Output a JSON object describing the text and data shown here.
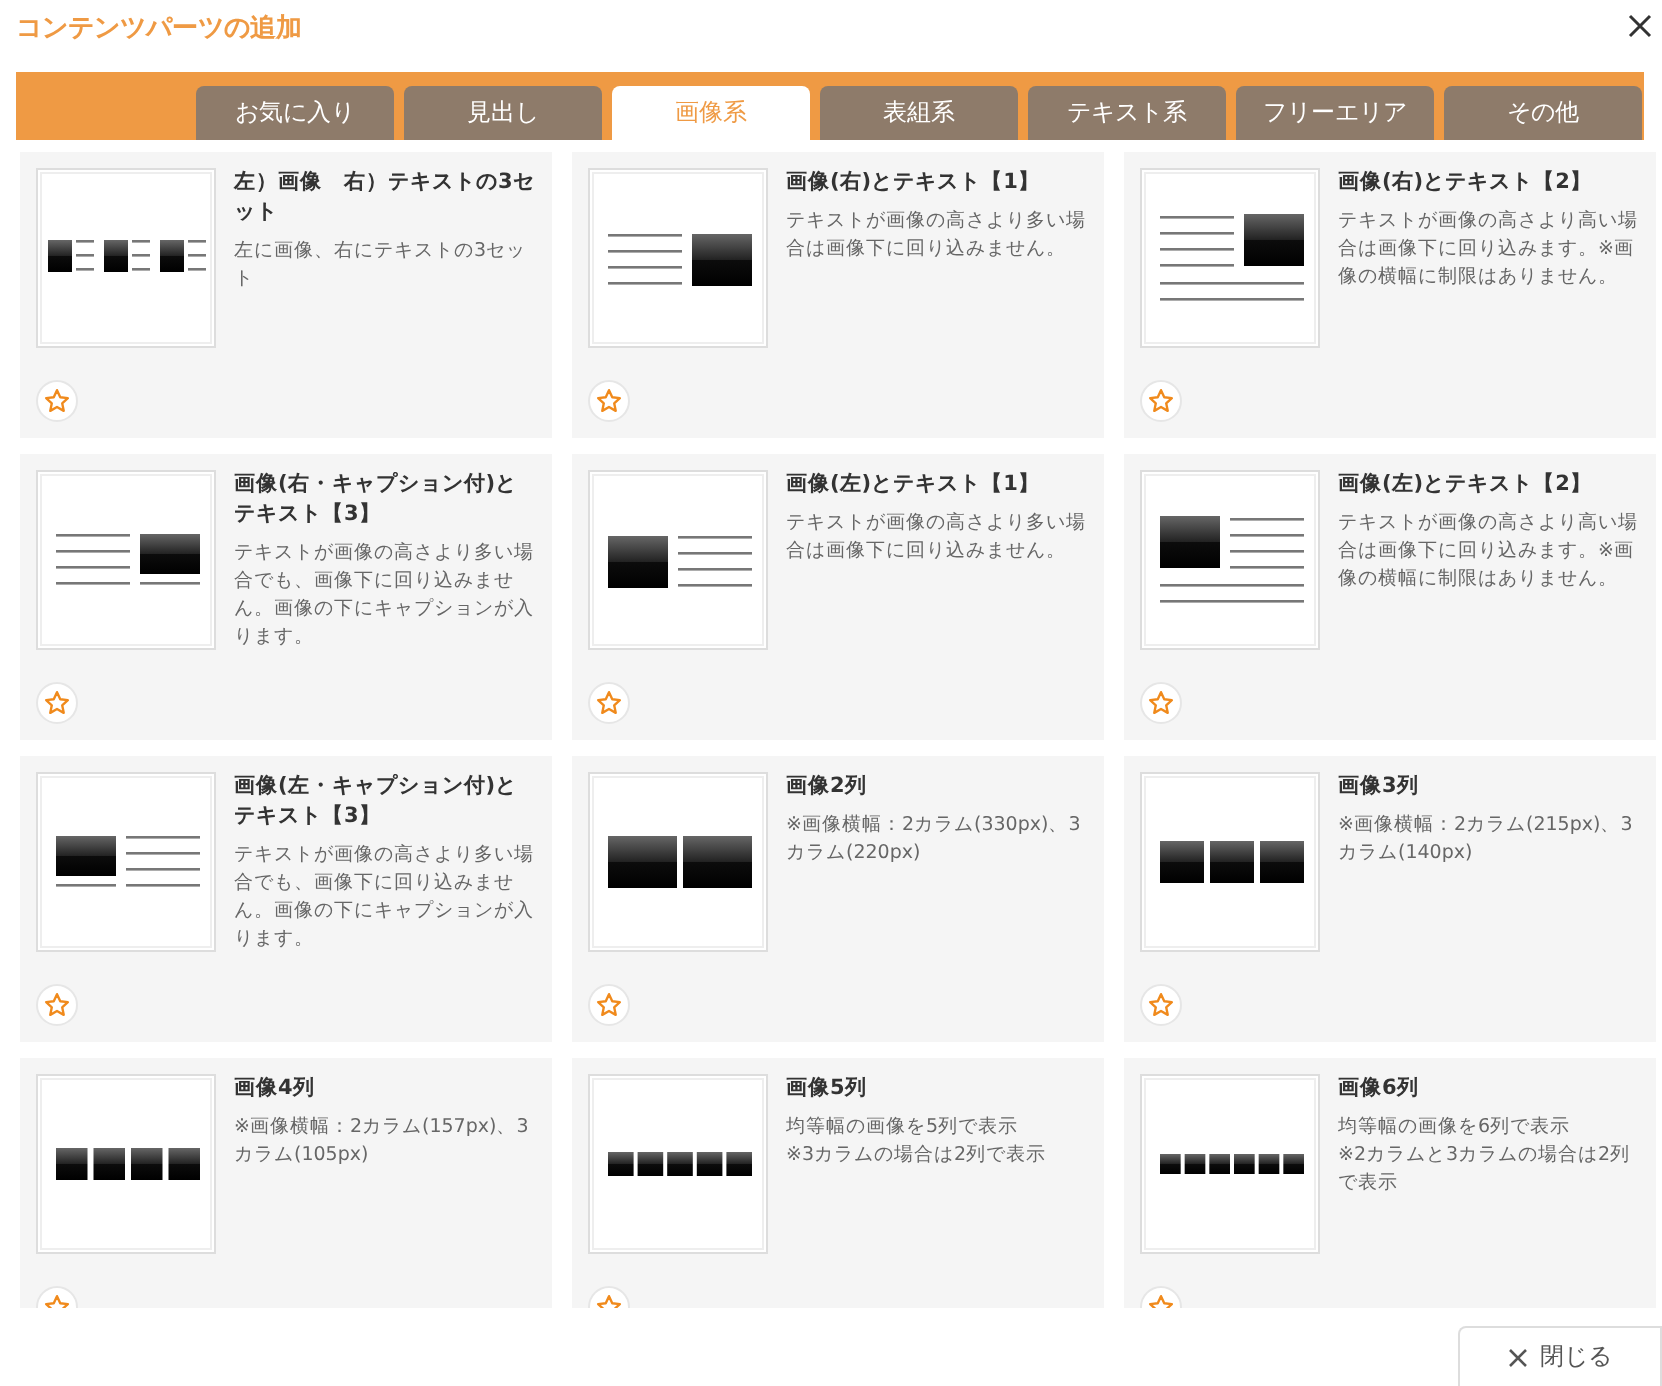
{
  "dialog": {
    "title": "コンテンツパーツの追加",
    "close_label": "閉じる"
  },
  "tabs": [
    {
      "label": "お気に入り",
      "selected": false
    },
    {
      "label": "見出し",
      "selected": false
    },
    {
      "label": "画像系",
      "selected": true
    },
    {
      "label": "表組系",
      "selected": false
    },
    {
      "label": "テキスト系",
      "selected": false
    },
    {
      "label": "フリーエリア",
      "selected": false
    },
    {
      "label": "その他",
      "selected": false
    }
  ],
  "parts": [
    {
      "kind": "set3",
      "title": "左）画像　右）テキストの3セット",
      "description": "左に画像、右にテキストの3セット"
    },
    {
      "kind": "right",
      "title": "画像(右)とテキスト【1】",
      "description": "テキストが画像の高さより多い場合は画像下に回り込みません。"
    },
    {
      "kind": "right_wrap",
      "title": "画像(右)とテキスト【2】",
      "description": "テキストが画像の高さより高い場合は画像下に回り込みます。※画像の横幅に制限はありません。"
    },
    {
      "kind": "right_caption",
      "title": "画像(右・キャプション付)とテキスト【3】",
      "description": "テキストが画像の高さより多い場合でも、画像下に回り込みません。画像の下にキャプションが入ります。"
    },
    {
      "kind": "left",
      "title": "画像(左)とテキスト【1】",
      "description": "テキストが画像の高さより多い場合は画像下に回り込みません。"
    },
    {
      "kind": "left_wrap",
      "title": "画像(左)とテキスト【2】",
      "description": "テキストが画像の高さより高い場合は画像下に回り込みます。※画像の横幅に制限はありません。"
    },
    {
      "kind": "left_caption",
      "title": "画像(左・キャプション付)とテキスト【3】",
      "description": "テキストが画像の高さより多い場合でも、画像下に回り込みません。画像の下にキャプションが入ります。"
    },
    {
      "kind": "cols2",
      "title": "画像2列",
      "description": "※画像横幅：2カラム(330px)、3カラム(220px)"
    },
    {
      "kind": "cols3",
      "title": "画像3列",
      "description": "※画像横幅：2カラム(215px)、3カラム(140px)"
    },
    {
      "kind": "cols4",
      "title": "画像4列",
      "description": "※画像横幅：2カラム(157px)、3カラム(105px)"
    },
    {
      "kind": "cols5",
      "title": "画像5列",
      "description": "均等幅の画像を5列で表示\n※3カラムの場合は2列で表示"
    },
    {
      "kind": "cols6",
      "title": "画像6列",
      "description": "均等幅の画像を6列で表示\n※2カラムと3カラムの場合は2列で表示"
    }
  ]
}
